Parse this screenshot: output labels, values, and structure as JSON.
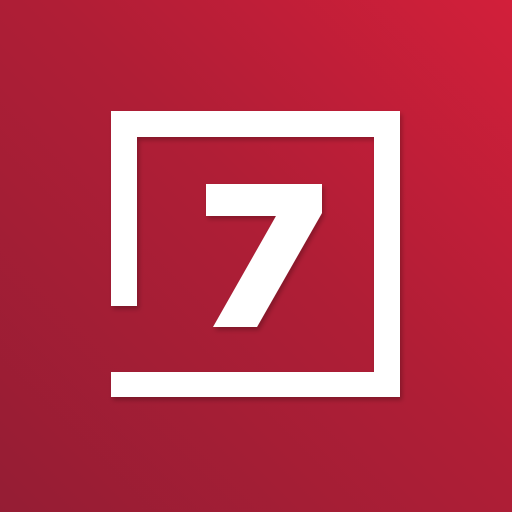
{
  "logo": {
    "label": "7",
    "icon": "seven-in-square-frame-logo"
  },
  "colors": {
    "background_top_right": "#d21f3a",
    "background_bottom_left": "#951d34",
    "foreground": "#ffffff"
  }
}
